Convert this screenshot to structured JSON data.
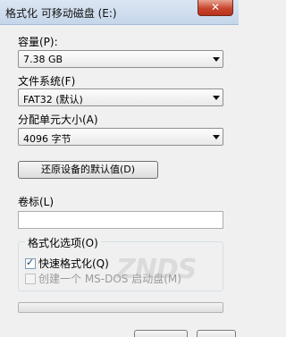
{
  "window": {
    "title": "格式化 可移动磁盘 (E:)",
    "close_glyph": "✕"
  },
  "capacity": {
    "label": "容量(P):",
    "value": "7.38 GB"
  },
  "filesystem": {
    "label": "文件系统(F)",
    "value": "FAT32 (默认)"
  },
  "allocation": {
    "label": "分配单元大小(A)",
    "value": "4096 字节"
  },
  "restore_defaults": {
    "label": "还原设备的默认值(D)"
  },
  "volume": {
    "label": "卷标(L)",
    "value": ""
  },
  "format_options": {
    "title": "格式化选项(O)",
    "quick_format": {
      "label": "快速格式化(Q)",
      "checked": true
    },
    "msdos_boot": {
      "label": "创建一个 MS-DOS 启动盘(M)",
      "checked": false,
      "enabled": false
    }
  },
  "progress": {
    "value": 0
  },
  "watermark": "ZNDS"
}
